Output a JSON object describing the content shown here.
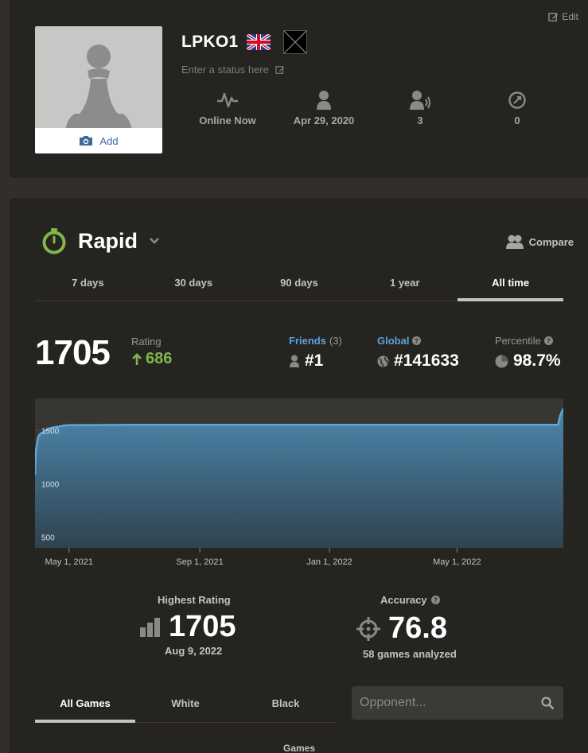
{
  "profile": {
    "edit_label": "Edit",
    "avatar_add_label": "Add",
    "username": "LPKO1",
    "status_placeholder": "Enter a status here",
    "stats": [
      {
        "icon": "activity-icon",
        "label": "Online Now"
      },
      {
        "icon": "person-icon",
        "label": "Apr 29, 2020"
      },
      {
        "icon": "followers-icon",
        "label": "3"
      },
      {
        "icon": "views-icon",
        "label": "0"
      }
    ]
  },
  "stats": {
    "mode": "Rapid",
    "compare_label": "Compare",
    "ranges": [
      "7 days",
      "30 days",
      "90 days",
      "1 year",
      "All time"
    ],
    "active_range": "All time",
    "rating": "1705",
    "rating_label": "Rating",
    "rating_change": "686",
    "friends_label": "Friends",
    "friends_count": "(3)",
    "friends_rank": "#1",
    "global_label": "Global",
    "global_rank": "#141633",
    "percentile_label": "Percentile",
    "percentile": "98.7%",
    "highest_label": "Highest Rating",
    "highest_value": "1705",
    "highest_date": "Aug 9, 2022",
    "accuracy_label": "Accuracy",
    "accuracy_value": "76.8",
    "games_analyzed": "58 games analyzed",
    "game_tabs": [
      "All Games",
      "White",
      "Black"
    ],
    "active_game_tab": "All Games",
    "opponent_placeholder": "Opponent...",
    "games_column": "Games"
  },
  "colors": {
    "accent_green": "#81b64c",
    "link_blue": "#5ba3d9",
    "chart_line": "#5ca8d6"
  },
  "chart_data": {
    "type": "area",
    "title": "",
    "xlabel": "",
    "ylabel": "",
    "ylim": [
      400,
      1800
    ],
    "y_ticks": [
      500,
      1000,
      1500
    ],
    "x_tick_labels": [
      "May 1, 2021",
      "Sep 1, 2021",
      "Jan 1, 2022",
      "May 1, 2022"
    ],
    "x_tick_days": [
      0,
      123,
      245,
      365
    ],
    "x_range_days": [
      -32,
      465
    ],
    "series": [
      {
        "x": [
          -32,
          -31,
          -29,
          -27,
          -25,
          -22,
          -18,
          -14,
          -10,
          -5,
          0,
          60,
          120,
          200,
          280,
          340,
          400,
          440,
          460,
          462,
          465
        ],
        "y": [
          1080,
          1320,
          1440,
          1470,
          1480,
          1500,
          1520,
          1530,
          1535,
          1545,
          1550,
          1552,
          1552,
          1553,
          1553,
          1553,
          1553,
          1553,
          1553,
          1640,
          1705
        ]
      }
    ],
    "grid": true
  }
}
